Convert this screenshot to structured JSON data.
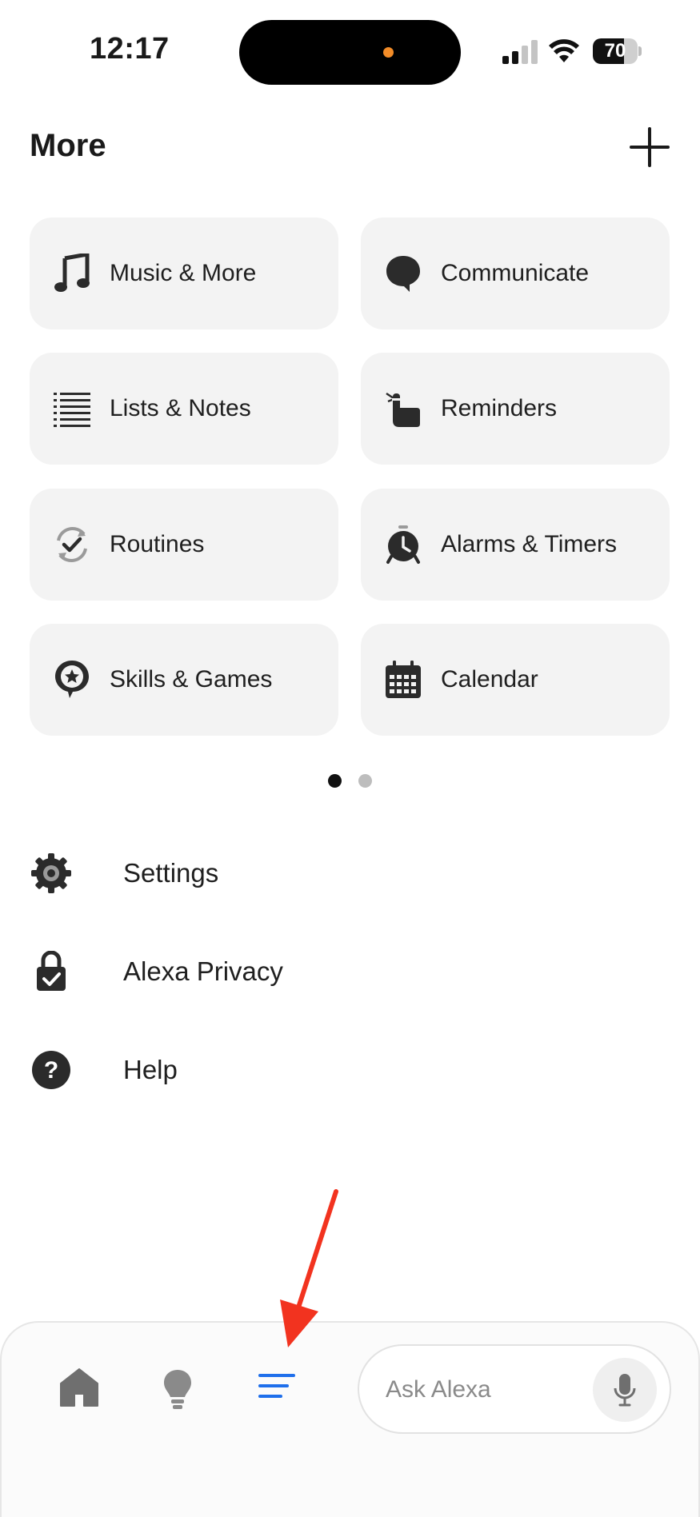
{
  "status_bar": {
    "time": "12:17",
    "battery_level": "70",
    "battery_fraction": 0.7,
    "icons": [
      "cellular-signal-icon",
      "wifi-icon",
      "battery-icon"
    ]
  },
  "header": {
    "title": "More",
    "add_icon": "plus-icon"
  },
  "tiles": [
    {
      "label": "Music & More",
      "icon": "music-note-icon"
    },
    {
      "label": "Communicate",
      "icon": "chat-bubble-icon"
    },
    {
      "label": "Lists & Notes",
      "icon": "list-icon"
    },
    {
      "label": "Reminders",
      "icon": "finger-string-icon"
    },
    {
      "label": "Routines",
      "icon": "routine-check-icon"
    },
    {
      "label": "Alarms & Timers",
      "icon": "alarm-clock-icon"
    },
    {
      "label": "Skills & Games",
      "icon": "star-bubble-icon"
    },
    {
      "label": "Calendar",
      "icon": "calendar-icon"
    }
  ],
  "pagination": {
    "pages": 2,
    "current": 1
  },
  "menu": [
    {
      "label": "Settings",
      "icon": "gear-icon"
    },
    {
      "label": "Alexa Privacy",
      "icon": "lock-check-icon"
    },
    {
      "label": "Help",
      "icon": "help-icon"
    }
  ],
  "bottom_nav": {
    "items": [
      {
        "name": "home",
        "icon": "home-icon",
        "active": false
      },
      {
        "name": "devices",
        "icon": "lightbulb-icon",
        "active": false
      },
      {
        "name": "more",
        "icon": "menu-lines-icon",
        "active": true
      }
    ],
    "ask_placeholder": "Ask Alexa",
    "mic_icon": "microphone-icon"
  },
  "colors": {
    "active": "#1f6feb",
    "inactive": "#777777",
    "tile_bg": "#f3f3f3",
    "annotation_arrow": "#f2331f"
  }
}
